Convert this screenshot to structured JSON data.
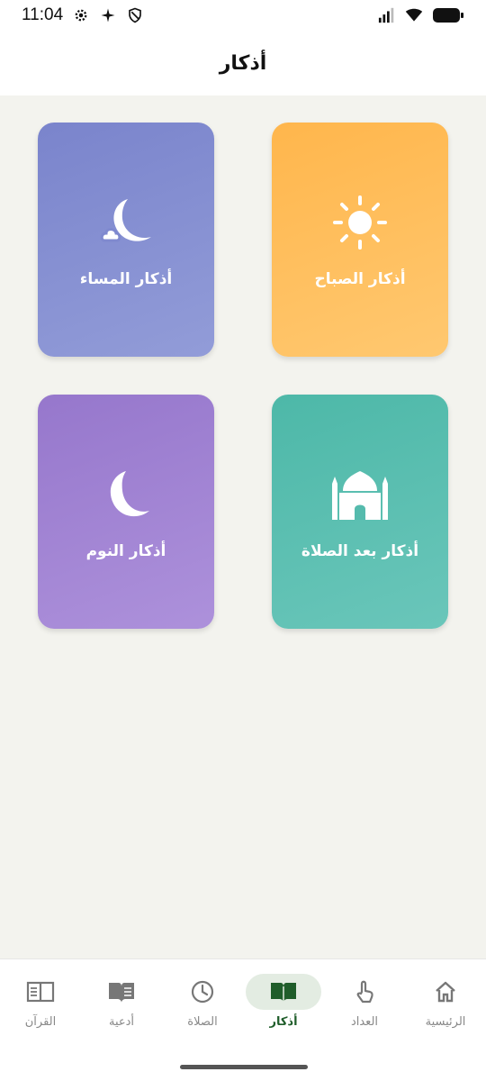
{
  "status_bar": {
    "time": "11:04",
    "icons": [
      "settings-icon",
      "sparkle-icon",
      "shield-icon",
      "signal-icon",
      "wifi-icon",
      "battery-icon"
    ]
  },
  "header": {
    "title": "أذكار"
  },
  "cards": [
    {
      "label": "أذكار الصباح",
      "icon": "sun-icon",
      "color": "#ffb64c"
    },
    {
      "label": "أذكار المساء",
      "icon": "crescent-cloud-icon",
      "color": "#7a84cc"
    },
    {
      "label": "أذكار بعد الصلاة",
      "icon": "mosque-icon",
      "color": "#4db8a8"
    },
    {
      "label": "أذكار النوم",
      "icon": "crescent-moon-icon",
      "color": "#9677cc"
    }
  ],
  "bottom_nav": {
    "active": "أذكار",
    "items": [
      {
        "label": "الرئيسية",
        "icon": "home-icon"
      },
      {
        "label": "العداد",
        "icon": "tap-icon"
      },
      {
        "label": "أذكار",
        "icon": "open-book-icon"
      },
      {
        "label": "الصلاة",
        "icon": "clock-icon"
      },
      {
        "label": "أدعية",
        "icon": "book-icon"
      },
      {
        "label": "القرآن",
        "icon": "quran-icon"
      }
    ]
  },
  "colors": {
    "accent": "#1f5d2a",
    "background": "#f3f3ee"
  }
}
